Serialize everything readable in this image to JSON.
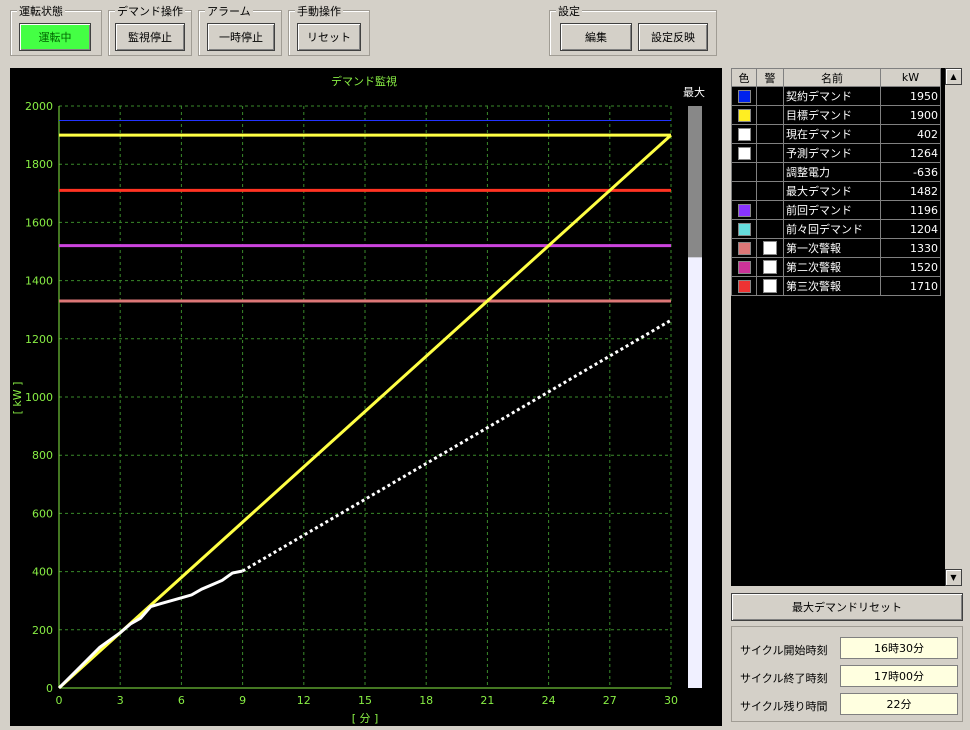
{
  "groups": {
    "run_state": {
      "title": "運転状態",
      "button": "運転中"
    },
    "demand_op": {
      "title": "デマンド操作",
      "button": "監視停止"
    },
    "alarm": {
      "title": "アラーム",
      "button": "一時停止"
    },
    "manual_op": {
      "title": "手動操作",
      "button": "リセット"
    },
    "settings": {
      "title": "設定",
      "edit_button": "編集",
      "apply_button": "設定反映"
    }
  },
  "chart": {
    "max_label": "最大",
    "max_bar_fraction": 0.26
  },
  "chart_data": {
    "type": "line",
    "title": "デマンド監視",
    "xlabel": "[ 分 ]",
    "ylabel": "[ kW ]",
    "xlim": [
      0,
      30
    ],
    "ylim": [
      0,
      2000
    ],
    "xticks": [
      0,
      3,
      6,
      9,
      12,
      15,
      18,
      21,
      24,
      27,
      30
    ],
    "yticks": [
      0,
      200,
      400,
      600,
      800,
      1000,
      1200,
      1400,
      1600,
      1800,
      2000
    ],
    "grid": true,
    "horizontal_lines": [
      {
        "value": 1950,
        "color": "#2233ff"
      },
      {
        "value": 1900,
        "color": "#ffff44"
      },
      {
        "value": 1710,
        "color": "#ff3322"
      },
      {
        "value": 1520,
        "color": "#cc44dd"
      },
      {
        "value": 1330,
        "color": "#dd7777"
      }
    ],
    "series": [
      {
        "color": "#ffff44",
        "style": "solid",
        "x": [
          0,
          30
        ],
        "y": [
          0,
          1900
        ]
      },
      {
        "color": "#ffffff",
        "style": "solid",
        "x": [
          0,
          1,
          2,
          3,
          3.5,
          4,
          4.5,
          5,
          6,
          6.5,
          7,
          7.5,
          8,
          8.5,
          9
        ],
        "y": [
          0,
          70,
          140,
          190,
          220,
          240,
          280,
          290,
          310,
          320,
          340,
          355,
          370,
          395,
          402
        ]
      },
      {
        "color": "#ffffff",
        "style": "dotted",
        "x": [
          9,
          30
        ],
        "y": [
          402,
          1264
        ]
      }
    ]
  },
  "legend_table": {
    "headers": [
      "色",
      "警",
      "名前",
      "kW"
    ],
    "rows": [
      {
        "color": "#0022ee",
        "check": false,
        "name": "契約デマンド",
        "value": "1950"
      },
      {
        "color": "#ffee22",
        "check": false,
        "name": "目標デマンド",
        "value": "1900"
      },
      {
        "color": "#ffffff",
        "check": false,
        "name": "現在デマンド",
        "value": "402"
      },
      {
        "color": "#ffffff",
        "check": false,
        "name": "予測デマンド",
        "value": "1264"
      },
      {
        "color": "",
        "check": false,
        "name": "調整電力",
        "value": "-636"
      },
      {
        "color": "",
        "check": false,
        "name": "最大デマンド",
        "value": "1482"
      },
      {
        "color": "#8833ff",
        "check": false,
        "name": "前回デマンド",
        "value": "1196"
      },
      {
        "color": "#66dddd",
        "check": false,
        "name": "前々回デマンド",
        "value": "1204"
      },
      {
        "color": "#dd7777",
        "check": true,
        "name": "第一次警報",
        "value": "1330"
      },
      {
        "color": "#cc3399",
        "check": true,
        "name": "第二次警報",
        "value": "1520"
      },
      {
        "color": "#ee3333",
        "check": true,
        "name": "第三次警報",
        "value": "1710"
      }
    ]
  },
  "reset_max_label": "最大デマンドリセット",
  "info": {
    "cycle_start_label": "サイクル開始時刻",
    "cycle_start": "16時30分",
    "cycle_end_label": "サイクル終了時刻",
    "cycle_end": "17時00分",
    "remaining_label": "サイクル残り時間",
    "remaining": "22分"
  }
}
